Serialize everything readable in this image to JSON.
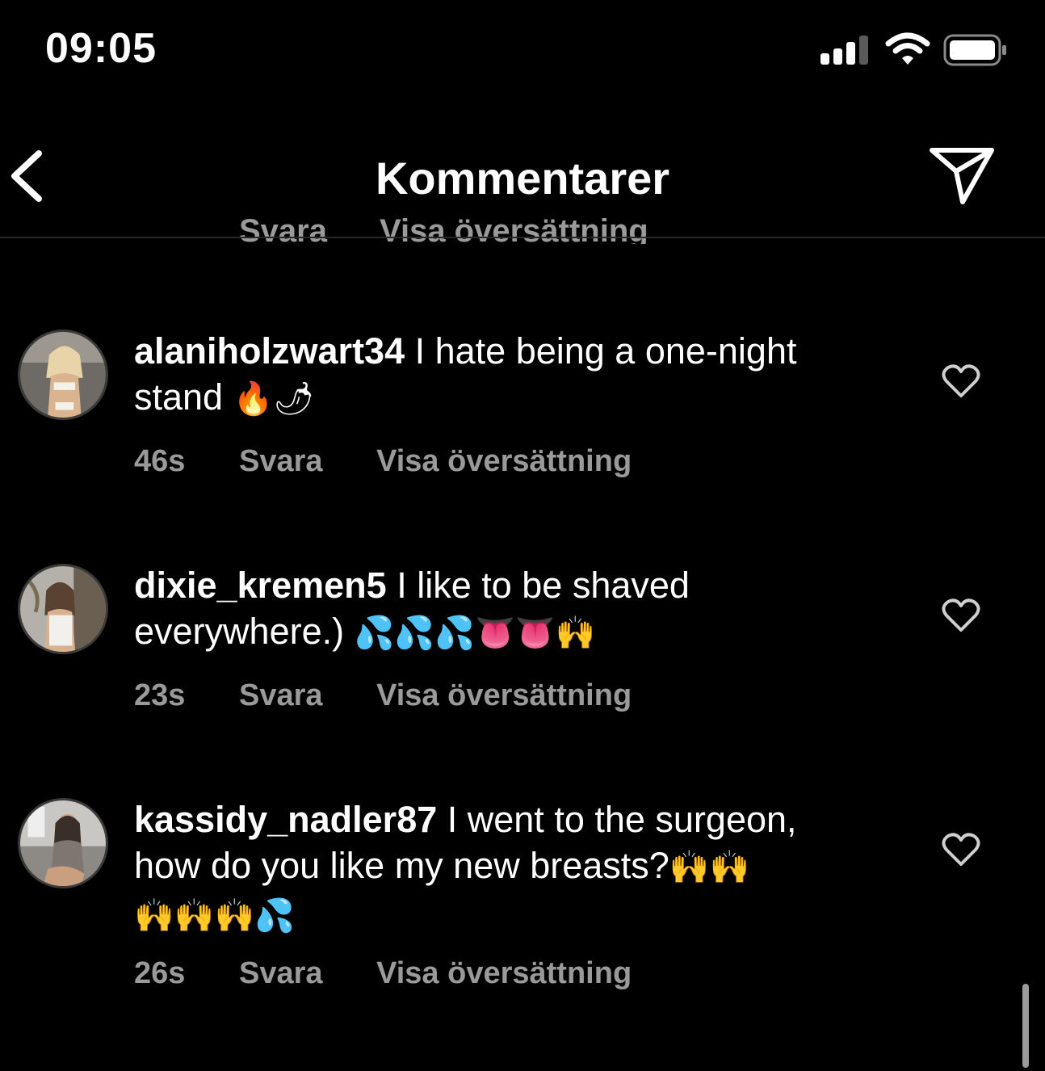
{
  "status_bar": {
    "time": "09:05",
    "icons": [
      "cellular-signal-icon",
      "wifi-icon",
      "battery-icon"
    ]
  },
  "header": {
    "title": "Kommentarer",
    "back_icon": "chevron-left-icon",
    "share_icon": "paper-plane-icon"
  },
  "comments": [
    {
      "username": "alaniholzwart34",
      "text_line1": " I hate being a one-night",
      "text_line2": "stand ",
      "emojis_line2": "🔥🌶",
      "age": "46s",
      "reply_label": "Svara",
      "translate_label": "Visa översättning"
    },
    {
      "username": "dixie_kremen5",
      "text_line1": " I like to be shaved",
      "text_line2": "everywhere.) ",
      "emojis_line2": "💦💦💦👅👅🙌",
      "age": "23s",
      "reply_label": "Svara",
      "translate_label": "Visa översättning"
    },
    {
      "username": "kassidy_nadler87",
      "text_line1": " I went to the surgeon,",
      "text_line2": "how do you like my new breasts?",
      "emojis_line2": "🙌🙌",
      "emojis_line3": "🙌🙌🙌💦",
      "age": "26s",
      "reply_label": "Svara",
      "translate_label": "Visa översättning"
    }
  ],
  "colors": {
    "background": "#000000",
    "text": "#ffffff",
    "secondary_text": "#9a9a9a",
    "divider": "#262626"
  }
}
